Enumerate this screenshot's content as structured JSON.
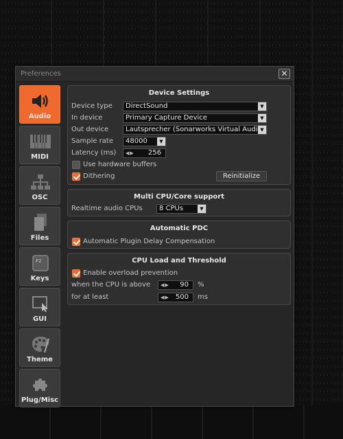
{
  "window": {
    "title": "Preferences",
    "close_label": "✕"
  },
  "sidebar": {
    "items": [
      {
        "label": "Audio",
        "icon": "speaker-icon",
        "active": true
      },
      {
        "label": "MIDI",
        "icon": "piano-keys-icon"
      },
      {
        "label": "OSC",
        "icon": "network-icon"
      },
      {
        "label": "Files",
        "icon": "files-icon"
      },
      {
        "label": "Keys",
        "icon": "keyboard-key-icon"
      },
      {
        "label": "GUI",
        "icon": "cursor-window-icon"
      },
      {
        "label": "Theme",
        "icon": "palette-icon"
      },
      {
        "label": "Plug/Misc",
        "icon": "puzzle-icon"
      }
    ]
  },
  "device_settings": {
    "title": "Device Settings",
    "device_type_label": "Device type",
    "device_type_value": "DirectSound",
    "in_device_label": "In device",
    "in_device_value": "Primary Capture Device",
    "out_device_label": "Out device",
    "out_device_value": "Lautsprecher (Sonarworks Virtual Audi...",
    "sample_rate_label": "Sample rate",
    "sample_rate_value": "48000",
    "latency_label": "Latency (ms)",
    "latency_value": "256",
    "hardware_buffers_label": "Use hardware buffers",
    "hardware_buffers_checked": false,
    "dithering_label": "Dithering",
    "dithering_checked": true,
    "reinitialize_label": "Reinitialize"
  },
  "multi_cpu": {
    "title": "Multi CPU/Core support",
    "realtime_label": "Realtime audio CPUs",
    "realtime_value": "8 CPUs"
  },
  "automatic_pdc": {
    "title": "Automatic PDC",
    "compensation_label": "Automatic Plugin Delay Compensation",
    "compensation_checked": true
  },
  "cpu_load": {
    "title": "CPU Load and Threshold",
    "overload_label": "Enable overload prevention",
    "overload_checked": true,
    "threshold_label": "when the CPU is above",
    "threshold_value": "90",
    "threshold_unit": "%",
    "duration_label": "for at least",
    "duration_value": "500",
    "duration_unit": "ms"
  },
  "colors": {
    "accent": "#f06a2e",
    "panel": "#2f2f2f",
    "window": "#262626"
  }
}
